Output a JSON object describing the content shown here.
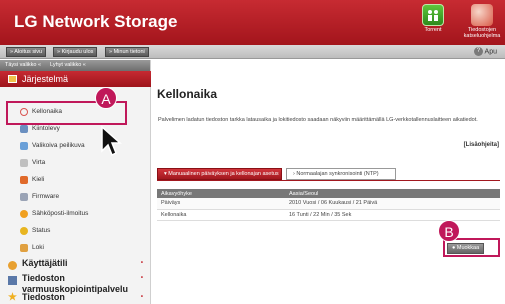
{
  "header": {
    "brand": "LG Network Storage",
    "apps": [
      {
        "label": "Torrent",
        "icon": "torrent-icon"
      },
      {
        "label": "Tiedostojen katseluohjelma",
        "icon": "file-viewer-icon"
      }
    ]
  },
  "topbar": {
    "buttons": [
      "» Aloitus sivu",
      "» Kirjaudu ulos",
      "» Minun tietoni"
    ],
    "help": "Apu"
  },
  "sidebar": {
    "tabs": [
      "Täysi valikko «",
      "Lyhyt valikko «"
    ],
    "section_system": "Järjestelmä",
    "items": [
      {
        "label": "Kellonaika",
        "icon": "clock-icon",
        "color": "#d9534f"
      },
      {
        "label": "Kiintolevy",
        "icon": "disk-icon",
        "color": "#6a8fc0"
      },
      {
        "label": "Valikoiva peilikuva",
        "icon": "mirror-icon",
        "color": "#6aa0d8"
      },
      {
        "label": "Virta",
        "icon": "power-icon",
        "color": "#c0c0c0"
      },
      {
        "label": "Kieli",
        "icon": "language-icon",
        "color": "#e06a2a"
      },
      {
        "label": "Firmware",
        "icon": "firmware-icon",
        "color": "#9aa3b5"
      },
      {
        "label": "Sähköposti-ilmoitus",
        "icon": "email-icon",
        "color": "#f0a020"
      },
      {
        "label": "Status",
        "icon": "status-icon",
        "color": "#e8b520"
      },
      {
        "label": "Loki",
        "icon": "log-icon",
        "color": "#e0a040"
      }
    ],
    "sections": [
      {
        "label": "Käyttäjätili",
        "icon": "users-icon",
        "color": "#e8a030"
      },
      {
        "label": "Tiedoston varmuuskopiointipalvelu",
        "icon": "backup-icon",
        "color": "#5a78a8"
      },
      {
        "label": "Tiedoston",
        "icon": "star-icon",
        "color": "#f0b020"
      }
    ],
    "expand_mark": "•"
  },
  "main": {
    "title": "Kellonaika",
    "description": "Palvelimen ladatun tiedoston tarkka latausaika ja lokitiedosto saadaan näkyviin määrittämällä LG-verkkotallennuslaitteen aikatiedot.",
    "more_link": "[Lisäohjeita]",
    "tabs": [
      "Manuaalinen päiväyksen ja kellonajan asetus",
      "Normaalajan synkronisointi (NTP)"
    ],
    "table": {
      "header": [
        "Aikavyöhyke",
        "Aasia/Seoul"
      ],
      "rows": [
        [
          "Päiväys",
          "2010 Vuosi / 06 Kuukausi / 21 Päivä"
        ],
        [
          "Kellonaika",
          "16 Tunti / 22 Min / 35 Sek"
        ]
      ]
    },
    "edit_button": "Muokkaa"
  },
  "callouts": {
    "a": "A",
    "b": "B"
  },
  "accent_color": "#c0185a"
}
